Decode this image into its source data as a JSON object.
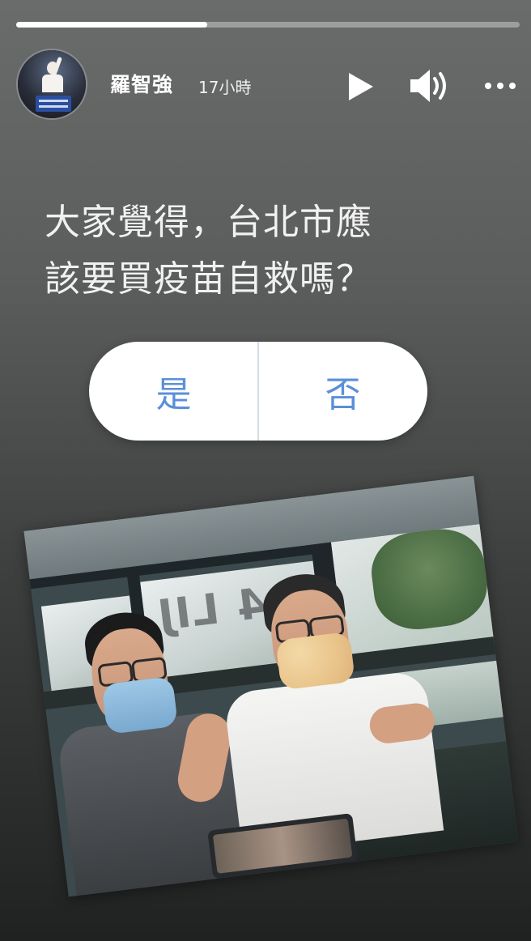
{
  "story": {
    "progress": 0.38
  },
  "header": {
    "username": "羅智強",
    "timestamp": "17小時",
    "icons": [
      "play-icon",
      "volume-icon",
      "more-icon"
    ]
  },
  "question": {
    "line1": "大家覺得，台北市應",
    "line2": "該要買疫苗自救嗎？"
  },
  "poll": {
    "yes_label": "是",
    "no_label": "否"
  },
  "photo": {
    "sign_text": "304 LIJ"
  },
  "colors": {
    "poll_text": "#5b8fd9",
    "poll_bg": "#ffffff"
  }
}
